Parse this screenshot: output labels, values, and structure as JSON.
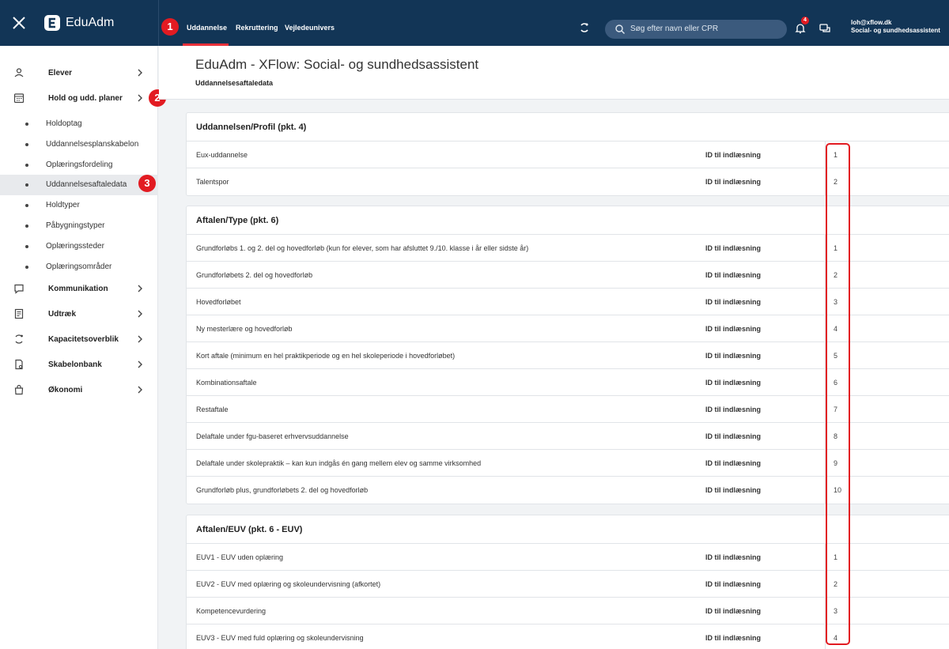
{
  "topbar": {
    "brand": "EduAdm",
    "tabs": [
      {
        "label": "Uddannelse"
      },
      {
        "label": "Rekruttering"
      },
      {
        "label": "Vejledeunivers"
      }
    ],
    "search_placeholder": "Søg efter navn eller CPR",
    "notification_count": "4",
    "user_email": "loh@xflow.dk",
    "user_role": "Social- og sundhedsassistent"
  },
  "markers": [
    "1",
    "2",
    "3"
  ],
  "sidebar": {
    "items": [
      {
        "label": "Elever",
        "icon": "person-icon"
      },
      {
        "label": "Hold og udd. planer",
        "icon": "calendar-icon"
      },
      {
        "label": "Kommunikation",
        "icon": "chat-icon"
      },
      {
        "label": "Udtræk",
        "icon": "document-icon"
      },
      {
        "label": "Kapacitetsoverblik",
        "icon": "capacity-icon"
      },
      {
        "label": "Skabelonbank",
        "icon": "template-icon"
      },
      {
        "label": "Økonomi",
        "icon": "bag-icon"
      }
    ],
    "subitems": [
      {
        "label": "Holdoptag"
      },
      {
        "label": "Uddannelsesplanskabelon"
      },
      {
        "label": "Oplæringsfordeling"
      },
      {
        "label": "Uddannelsesaftaledata"
      },
      {
        "label": "Holdtyper"
      },
      {
        "label": "Påbygningstyper"
      },
      {
        "label": "Oplæringssteder"
      },
      {
        "label": "Oplæringsområder"
      }
    ]
  },
  "page": {
    "title": "EduAdm - XFlow: Social- og sundhedsassistent",
    "subtitle": "Uddannelsesaftaledata"
  },
  "id_label": "ID til indlæsning",
  "sections": [
    {
      "title": "Uddannelsen/Profil (pkt. 4)",
      "rows": [
        {
          "name": "Eux-uddannelse",
          "value": "1"
        },
        {
          "name": "Talentspor",
          "value": "2"
        }
      ]
    },
    {
      "title": "Aftalen/Type (pkt. 6)",
      "rows": [
        {
          "name": "Grundforløbs 1. og 2. del og hovedforløb (kun for elever, som har afsluttet 9./10. klasse i år eller sidste år)",
          "value": "1"
        },
        {
          "name": "Grundforløbets 2. del og hovedforløb",
          "value": "2"
        },
        {
          "name": "Hovedforløbet",
          "value": "3"
        },
        {
          "name": "Ny mesterlære og hovedforløb",
          "value": "4"
        },
        {
          "name": "Kort aftale (minimum en hel praktikperiode og en hel skoleperiode i hovedforløbet)",
          "value": "5"
        },
        {
          "name": "Kombinationsaftale",
          "value": "6"
        },
        {
          "name": "Restaftale",
          "value": "7"
        },
        {
          "name": "Delaftale under fgu-baseret erhvervsuddannelse",
          "value": "8"
        },
        {
          "name": "Delaftale under skolepraktik – kan kun indgås én gang mellem elev og samme virksomhed",
          "value": "9"
        },
        {
          "name": "Grundforløb plus, grundforløbets 2. del og hovedforløb",
          "value": "10"
        }
      ]
    },
    {
      "title": "Aftalen/EUV (pkt. 6 - EUV)",
      "rows": [
        {
          "name": "EUV1 - EUV uden oplæring",
          "value": "1"
        },
        {
          "name": "EUV2 - EUV med oplæring og skoleundervisning (afkortet)",
          "value": "2"
        },
        {
          "name": "Kompetencevurdering",
          "value": "3"
        },
        {
          "name": "EUV3 - EUV med fuld oplæring og skoleundervisning",
          "value": "4"
        }
      ]
    }
  ]
}
